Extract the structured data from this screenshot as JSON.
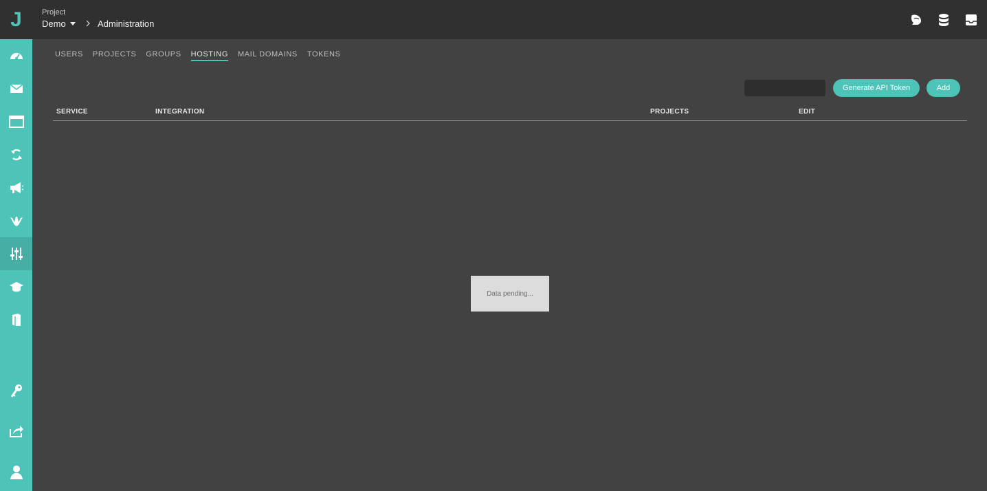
{
  "header": {
    "logo": "J",
    "project_label": "Project",
    "project_name": "Demo",
    "breadcrumb_page": "Administration",
    "icons": [
      "chat-bubble-icon",
      "database-icon",
      "inbox-icon"
    ]
  },
  "sidebar": {
    "items": [
      {
        "icon": "dashboard-icon"
      },
      {
        "icon": "mail-icon"
      },
      {
        "icon": "browser-window-icon"
      },
      {
        "icon": "sync-icon"
      },
      {
        "icon": "megaphone-icon"
      },
      {
        "icon": "handshake-icon"
      },
      {
        "icon": "sliders-icon",
        "active": true
      },
      {
        "icon": "graduation-cap-icon"
      },
      {
        "icon": "book-icon"
      },
      {
        "icon": "key-icon"
      },
      {
        "icon": "share-icon"
      },
      {
        "icon": "user-icon"
      }
    ]
  },
  "tabs": [
    "USERS",
    "PROJECTS",
    "GROUPS",
    "HOSTING",
    "MAIL DOMAINS",
    "TOKENS"
  ],
  "active_tab": "HOSTING",
  "toolbar": {
    "search_placeholder": "",
    "generate_label": "Generate API Token",
    "add_label": "Add"
  },
  "table": {
    "columns": [
      "SERVICE",
      "INTEGRATION",
      "PROJECTS",
      "EDIT"
    ]
  },
  "status": {
    "pending_text": "Data pending..."
  },
  "colors": {
    "accent": "#4ec3b8",
    "topbar": "#303030",
    "background": "#424242"
  }
}
